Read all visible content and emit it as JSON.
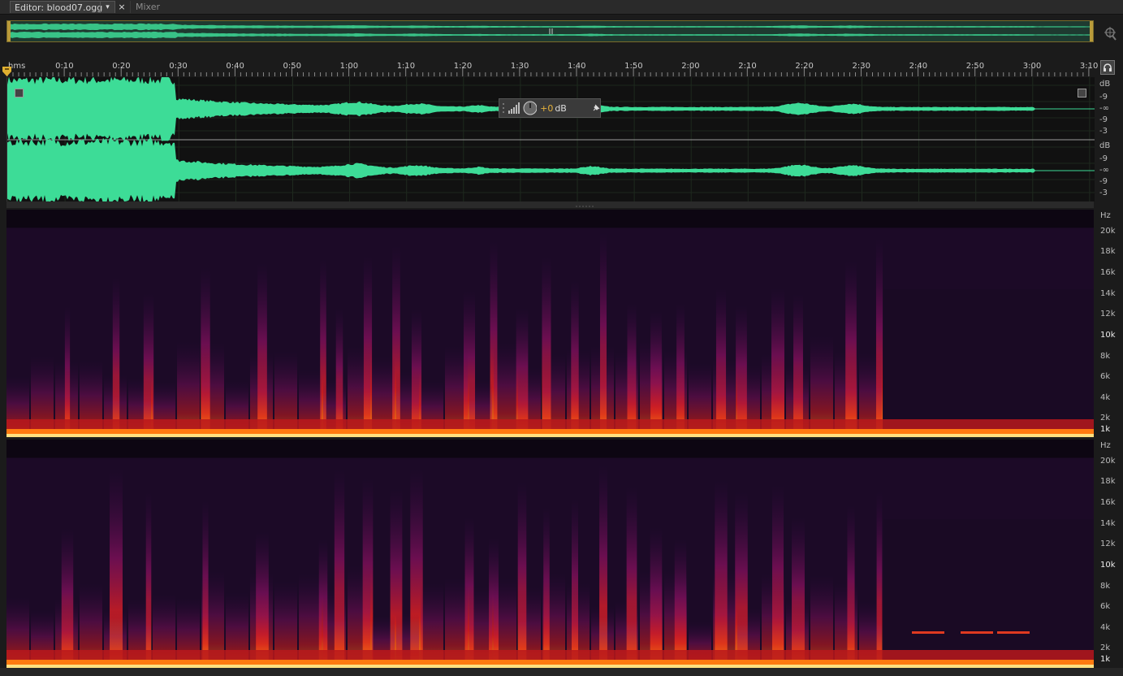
{
  "tabs": {
    "editor_label": "Editor: blood07.ogg",
    "dropdown_glyph": "▾",
    "close_glyph": "×",
    "mixer_label": "Mixer"
  },
  "ruler": {
    "unit_label": "hms",
    "ticks": [
      "0:10",
      "0:20",
      "0:30",
      "0:40",
      "0:50",
      "1:00",
      "1:10",
      "1:20",
      "1:30",
      "1:40",
      "1:50",
      "2:00",
      "2:10",
      "2:20",
      "2:30",
      "2:40",
      "2:50",
      "3:00",
      "3:10"
    ]
  },
  "waveform": {
    "color": "#3ddc97",
    "db_labels_top": [
      "dB",
      "-9",
      "-∞",
      "-9",
      "-3"
    ],
    "db_labels_bottom": [
      "dB",
      "-9",
      "-∞",
      "-9",
      "-3"
    ]
  },
  "hud": {
    "value": "+0",
    "unit": "dB"
  },
  "spectrum": {
    "hz_labels": [
      "Hz",
      "20k",
      "18k",
      "16k",
      "14k",
      "12k",
      "10k",
      "8k",
      "6k",
      "4k",
      "2k",
      "1k"
    ]
  },
  "icons": {
    "zoom": "magnify-icon",
    "headphones": "headphone-icon",
    "playhead": "playhead-icon",
    "pin": "pin-icon",
    "knob": "volume-knob-icon"
  }
}
